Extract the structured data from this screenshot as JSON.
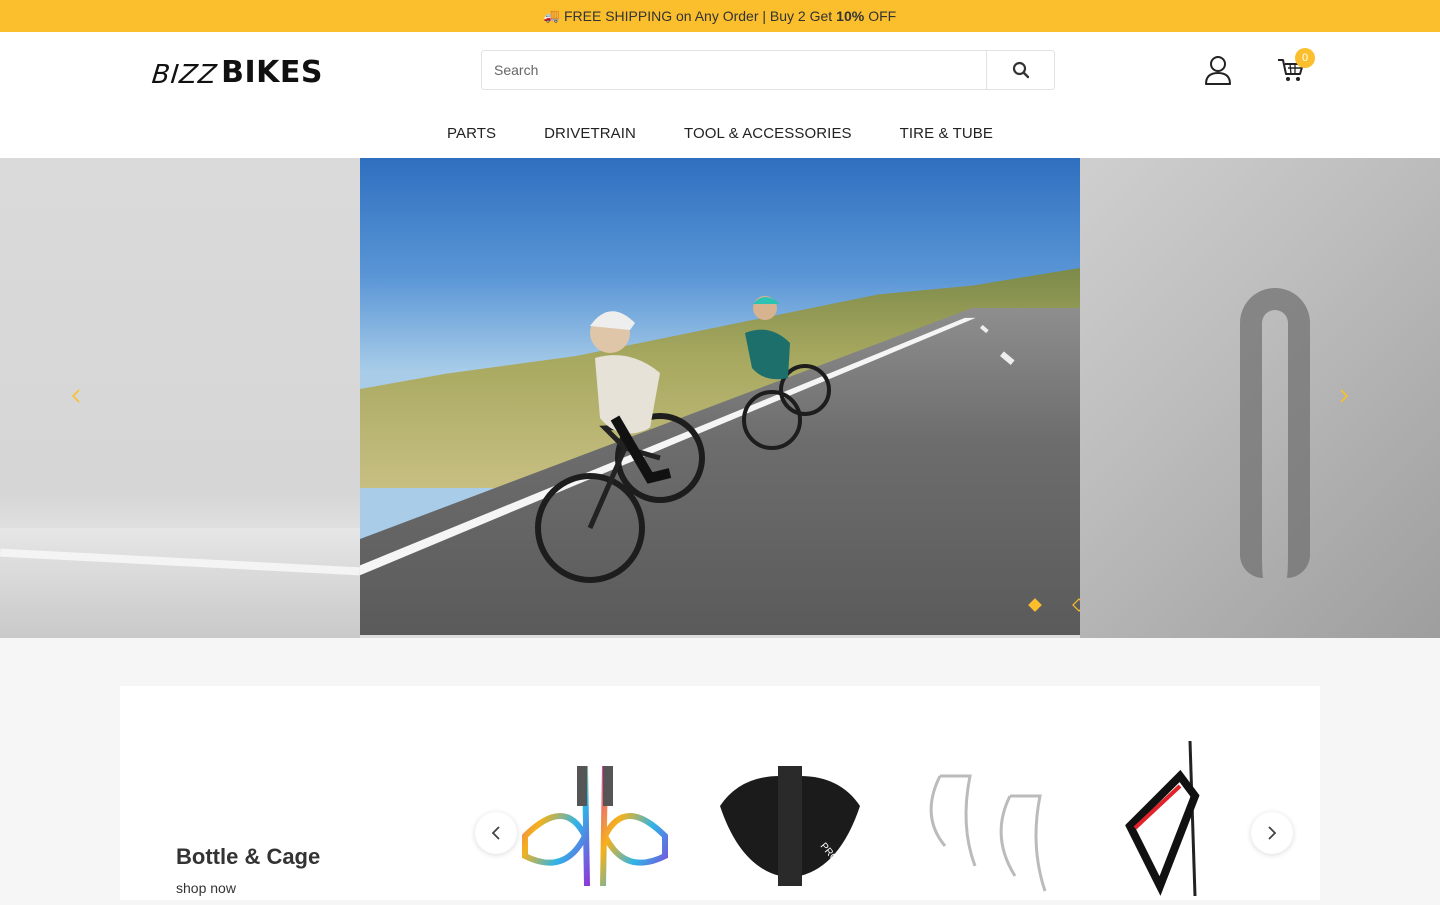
{
  "announcement": {
    "prefix": "FREE SHIPPING on Any Order | Buy 2 Get",
    "bold": "10%",
    "suffix": "OFF",
    "icon": "truck-icon"
  },
  "header": {
    "logo_part1": "BIZZ",
    "logo_part2": "BIKES",
    "search_placeholder": "Search",
    "cart_count": "0"
  },
  "nav": {
    "items": [
      {
        "label": "PARTS"
      },
      {
        "label": "DRIVETRAIN"
      },
      {
        "label": "TOOL & ACCESSORIES"
      },
      {
        "label": "TIRE & TUBE"
      }
    ]
  },
  "slider": {
    "active_index": 0,
    "count": 3,
    "accent": "#fbbf2d"
  },
  "section": {
    "title": "Bottle & Cage",
    "link": "shop now"
  },
  "colors": {
    "accent": "#fbbf2d"
  }
}
